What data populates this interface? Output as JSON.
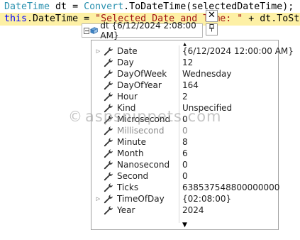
{
  "code": {
    "line1": {
      "type1": "DateTime",
      "mid1": " dt = ",
      "type2": "Convert",
      "rest": ".ToDateTime(selectedDateTime);"
    },
    "line2": {
      "kw": "this",
      "mid": ".DateTime = ",
      "str": "\"Selected Date and Time: \"",
      "rest": " + dt.ToSt"
    }
  },
  "watermark": {
    "symbol": "©",
    "text": "aspsnippets.com"
  },
  "datatip": {
    "header_label": "dt {6/12/2024 2:08:00 AM}",
    "close_glyph": "✕",
    "pin_glyph": "📌",
    "icons": [
      "collapse-icon",
      "object-icon",
      "close-icon",
      "pin-icon"
    ]
  },
  "properties": [
    {
      "name": "Date",
      "value": "{6/12/2024 12:00:00 AM}",
      "expandable": true,
      "dim": false
    },
    {
      "name": "Day",
      "value": "12",
      "expandable": false,
      "dim": false
    },
    {
      "name": "DayOfWeek",
      "value": "Wednesday",
      "expandable": false,
      "dim": false
    },
    {
      "name": "DayOfYear",
      "value": "164",
      "expandable": false,
      "dim": false
    },
    {
      "name": "Hour",
      "value": "2",
      "expandable": false,
      "dim": false
    },
    {
      "name": "Kind",
      "value": "Unspecified",
      "expandable": false,
      "dim": false
    },
    {
      "name": "Microsecond",
      "value": "0",
      "expandable": false,
      "dim": false
    },
    {
      "name": "Millisecond",
      "value": "0",
      "expandable": false,
      "dim": true
    },
    {
      "name": "Minute",
      "value": "8",
      "expandable": false,
      "dim": false
    },
    {
      "name": "Month",
      "value": "6",
      "expandable": false,
      "dim": false
    },
    {
      "name": "Nanosecond",
      "value": "0",
      "expandable": false,
      "dim": false
    },
    {
      "name": "Second",
      "value": "0",
      "expandable": false,
      "dim": false
    },
    {
      "name": "Ticks",
      "value": "638537548800000000",
      "expandable": false,
      "dim": false
    },
    {
      "name": "TimeOfDay",
      "value": "{02:08:00}",
      "expandable": true,
      "dim": false
    },
    {
      "name": "Year",
      "value": "2024",
      "expandable": false,
      "dim": false
    }
  ],
  "colors": {
    "highlight_line": "#fdf0a5",
    "type_color": "#2b91af",
    "keyword_color": "#0000ff",
    "string_color": "#a31515",
    "dim_text": "#8a8a8a"
  }
}
